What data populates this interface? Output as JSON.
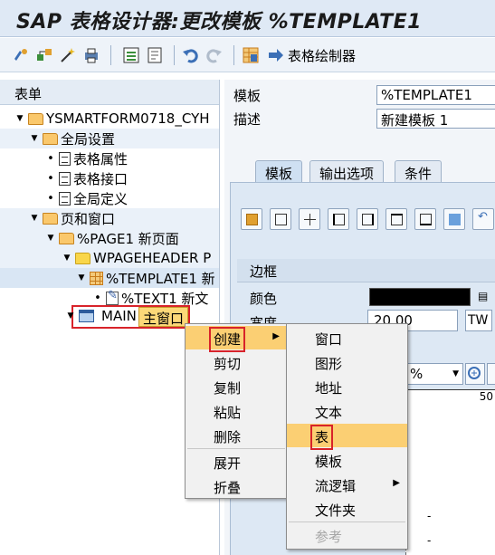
{
  "window": {
    "title": "SAP 表格设计器:更改模板 %TEMPLATE1"
  },
  "toolbar": {
    "icons": [
      "toggle-icon",
      "hierarchy-icon",
      "wizard-icon",
      "print-icon",
      "field-list-icon",
      "tree-icon",
      "undo-icon",
      "redo-icon",
      "table-painter-icon"
    ],
    "painter_label": "表格绘制器"
  },
  "tree": {
    "header": "表单",
    "nodes": [
      {
        "label": "YSMARTFORM0718_CYH",
        "icon": "folder-icon"
      },
      {
        "label": "全局设置",
        "icon": "folder-icon"
      },
      {
        "label": "表格属性",
        "icon": "document-icon"
      },
      {
        "label": "表格接口",
        "icon": "document-icon"
      },
      {
        "label": "全局定义",
        "icon": "document-icon"
      },
      {
        "label": "页和窗口",
        "icon": "folder-icon"
      },
      {
        "label": "%PAGE1 新页面",
        "icon": "folder-icon"
      },
      {
        "label": "WPAGEHEADER P",
        "icon": "folder-icon"
      },
      {
        "label": "%TEMPLATE1 新",
        "icon": "table-grid-icon"
      },
      {
        "label": "%TEXT1 新文",
        "icon": "text-edit-icon"
      },
      {
        "label": "MAIN",
        "icon": "window-icon",
        "tooltip": "主窗口"
      }
    ]
  },
  "form": {
    "template_label": "模板",
    "template_value": "%TEMPLATE1",
    "desc_label": "描述",
    "desc_value": "新建模板 1"
  },
  "tabs": [
    "模板",
    "输出选项",
    "条件"
  ],
  "border": {
    "section_label": "边框",
    "color_label": "颜色",
    "width_label": "宽度",
    "width_value": "20.00",
    "width_unit": "TW"
  },
  "zoom": {
    "percent_label": "%",
    "ruler_mark": "50"
  },
  "context_menu": {
    "items": [
      "创建",
      "剪切",
      "复制",
      "粘贴",
      "删除",
      "展开",
      "折叠"
    ]
  },
  "submenu": {
    "items": [
      "窗口",
      "图形",
      "地址",
      "文本",
      "表",
      "模板",
      "流逻辑",
      "文件夹",
      "参考"
    ]
  },
  "colors": {
    "highlight": "#fbcf73",
    "annotation_red": "#d8232a",
    "title_bg": "#dfe9f5"
  }
}
